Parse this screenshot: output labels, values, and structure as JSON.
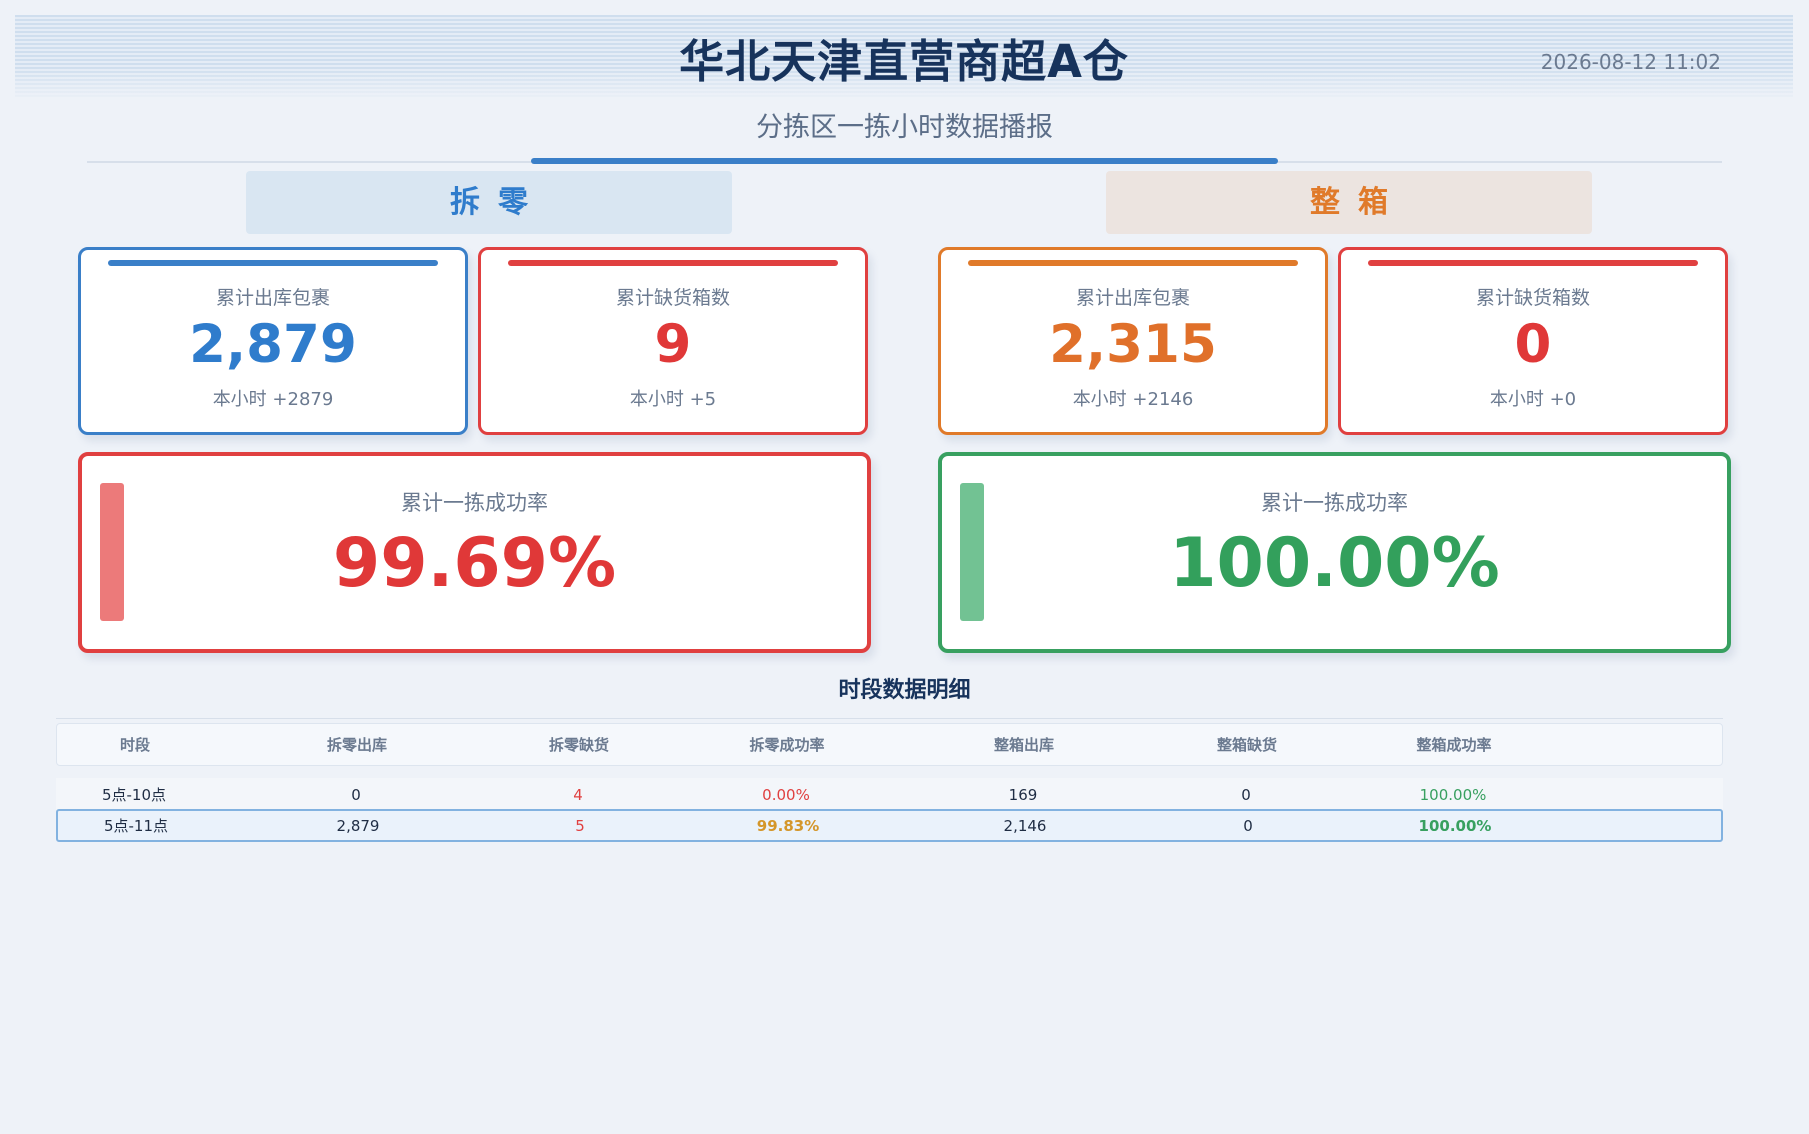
{
  "header": {
    "title": "华北天津直营商超A仓",
    "datetime": "2026-08-12 11:02",
    "subtitle": "分拣区一拣小时数据播报"
  },
  "sections": {
    "left_label": "拆零",
    "right_label": "整箱"
  },
  "split": {
    "outbound": {
      "label": "累计出库包裹",
      "value": "2,879",
      "sub": "本小时 +2879"
    },
    "shortage": {
      "label": "累计缺货箱数",
      "value": "9",
      "sub": "本小时 +5"
    },
    "rate": {
      "label": "累计一拣成功率",
      "value": "99.69%"
    }
  },
  "whole": {
    "outbound": {
      "label": "累计出库包裹",
      "value": "2,315",
      "sub": "本小时 +2146"
    },
    "shortage": {
      "label": "累计缺货箱数",
      "value": "0",
      "sub": "本小时 +0"
    },
    "rate": {
      "label": "累计一拣成功率",
      "value": "100.00%"
    }
  },
  "table": {
    "title": "时段数据明细",
    "headers": [
      "时段",
      "拆零出库",
      "拆零缺货",
      "拆零成功率",
      "整箱出库",
      "整箱缺货",
      "整箱成功率"
    ],
    "rows": [
      [
        "5点-10点",
        "0",
        "4",
        "0.00%",
        "169",
        "0",
        "100.00%"
      ],
      [
        "5点-11点",
        "2,879",
        "5",
        "99.83%",
        "2,146",
        "0",
        "100.00%"
      ]
    ]
  },
  "colors": {
    "blue": "#3a7fc8",
    "red": "#e04040",
    "orange": "#e07a2a",
    "green": "#38a060",
    "amber": "#d4962a",
    "title": "#17335c"
  }
}
